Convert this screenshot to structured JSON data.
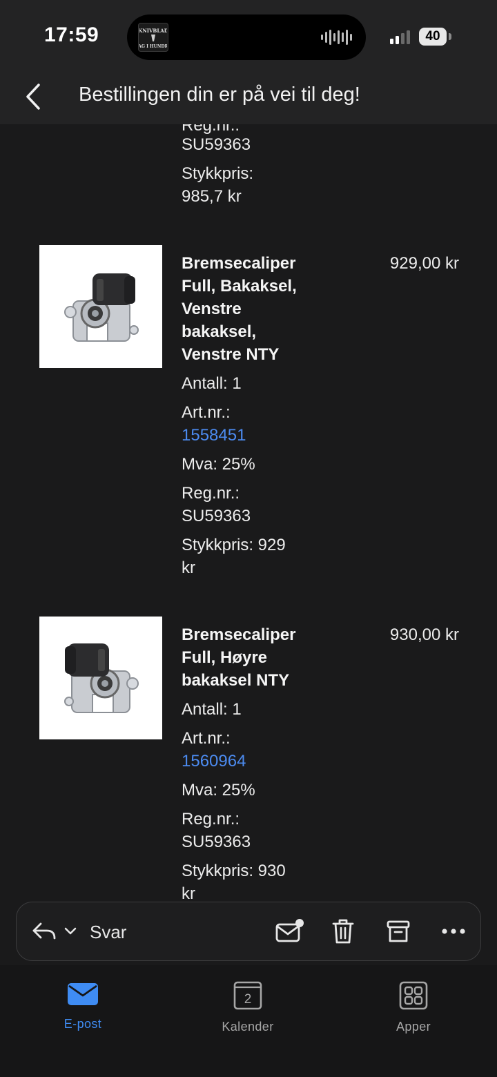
{
  "status_bar": {
    "time": "17:59",
    "battery": "40",
    "island_logo_text": "KNIVBLAD SAG I HUNDRE"
  },
  "header": {
    "title": "Bestillingen din er på vei til deg!"
  },
  "partial_item": {
    "regnr_label": "Reg.nr.:",
    "regnr_value": "SU59363",
    "unit_price_label": "Stykkpris:",
    "unit_price_value": "985,7 kr"
  },
  "items": [
    {
      "title_lines": [
        "Bremsecaliper",
        "Full, Bakaksel,",
        "Venstre",
        "bakaksel,",
        "Venstre NTY"
      ],
      "price": "929,00 kr",
      "antall": "Antall: 1",
      "artnr_label": "Art.nr.:",
      "artnr_value": "1558451",
      "mva": "Mva: 25%",
      "regnr_label": "Reg.nr.:",
      "regnr_value": "SU59363",
      "unit_price_lines": [
        "Stykkpris: 929",
        "kr"
      ]
    },
    {
      "title_lines": [
        "Bremsecaliper",
        "Full, Høyre",
        "bakaksel NTY"
      ],
      "price": "930,00 kr",
      "antall": "Antall: 1",
      "artnr_label": "Art.nr.:",
      "artnr_value": "1560964",
      "mva": "Mva: 25%",
      "regnr_label": "Reg.nr.:",
      "regnr_value": "SU59363",
      "unit_price_lines": [
        "Stykkpris: 930",
        "kr"
      ]
    }
  ],
  "action_bar": {
    "reply_label": "Svar"
  },
  "tabs": [
    {
      "label": "E-post",
      "icon": "mail-icon",
      "active": true
    },
    {
      "label": "Kalender",
      "icon": "calendar-icon",
      "badge": "2",
      "active": false
    },
    {
      "label": "Apper",
      "icon": "apps-grid-icon",
      "active": false
    }
  ],
  "colors": {
    "link": "#4c8bf0",
    "active_tab": "#3f8cf3",
    "background": "#1a1a1b"
  }
}
